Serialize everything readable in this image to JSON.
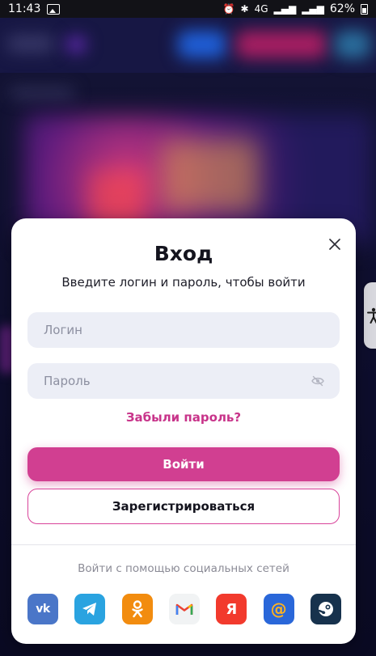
{
  "status_bar": {
    "time": "11:43",
    "network": "4G",
    "battery": "62%"
  },
  "modal": {
    "title": "Вход",
    "subtitle": "Введите логин и пароль, чтобы войти",
    "login_placeholder": "Логин",
    "login_value": "",
    "password_placeholder": "Пароль",
    "password_value": "",
    "forgot_label": "Забыли пароль?",
    "login_button": "Войти",
    "register_button": "Зарегистрироваться",
    "social_caption": "Войти с помощью социальных сетей",
    "socials": [
      {
        "name": "vk-icon",
        "glyph": "vk",
        "color": "#4a76c8"
      },
      {
        "name": "telegram-icon",
        "glyph": "",
        "color": "#2aa3e0"
      },
      {
        "name": "odnoklassniki-icon",
        "glyph": "",
        "color": "#f28c0f"
      },
      {
        "name": "gmail-icon",
        "glyph": "M",
        "color": "#f1f3f4"
      },
      {
        "name": "yandex-icon",
        "glyph": "Я",
        "color": "#f23a2d"
      },
      {
        "name": "mailru-icon",
        "glyph": "@",
        "color": "#2a67d9"
      },
      {
        "name": "steam-icon",
        "glyph": "",
        "color": "#17324d"
      }
    ]
  },
  "colors": {
    "accent": "#d13f91",
    "forgot_link": "#c8348a",
    "field_bg": "#eceef6"
  }
}
